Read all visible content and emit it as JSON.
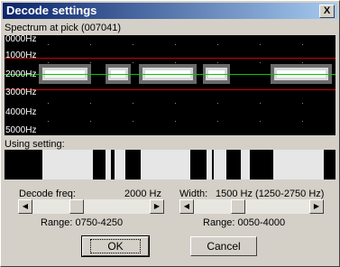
{
  "window": {
    "title": "Decode settings",
    "close_label": "X"
  },
  "spectrum": {
    "label": "Spectrum at pick (007041)",
    "freq_labels": [
      "0000Hz",
      "1000Hz",
      "2000Hz",
      "3000Hz",
      "4000Hz",
      "5000Hz"
    ]
  },
  "setting": {
    "label": "Using setting:"
  },
  "decode": {
    "label": "Decode freq:",
    "value": "2000 Hz",
    "range": "Range: 0750-4250",
    "slider_fraction": 0.36
  },
  "width": {
    "label": "Width:",
    "value": "1500 Hz (1250-2750 Hz)",
    "range": "Range: 0050-4000",
    "slider_fraction": 0.37
  },
  "buttons": {
    "ok": "OK",
    "cancel": "Cancel"
  },
  "colors": {
    "title_start": "#0a246a",
    "title_end": "#a6caf0",
    "red_line": "#cc0000",
    "green_line": "#00cc00",
    "face": "#d4d0c8"
  }
}
